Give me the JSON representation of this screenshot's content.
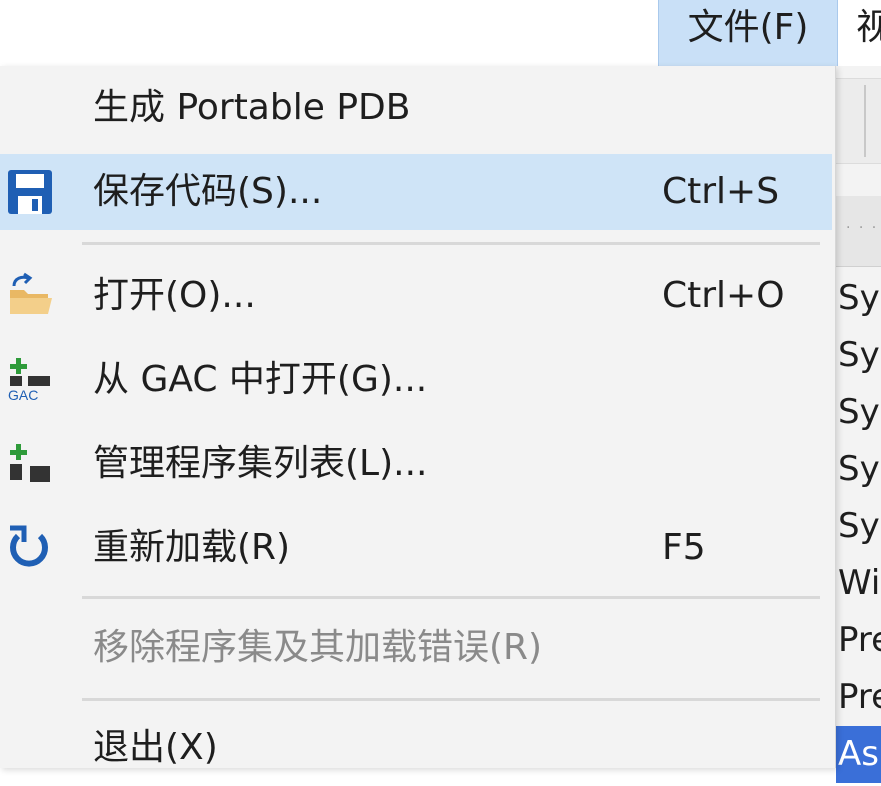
{
  "menubar": {
    "file_label": "文件(F)",
    "next_label": "视"
  },
  "menu": {
    "items": [
      {
        "label": "生成 Portable PDB",
        "shortcut": ""
      },
      {
        "label": "保存代码(S)...",
        "shortcut": "Ctrl+S",
        "icon": "save-icon"
      },
      {
        "label": "打开(O)...",
        "shortcut": "Ctrl+O",
        "icon": "open-folder-icon"
      },
      {
        "label": "从 GAC 中打开(G)...",
        "shortcut": "",
        "icon": "gac-icon"
      },
      {
        "label": "管理程序集列表(L)...",
        "shortcut": "",
        "icon": "assembly-list-icon"
      },
      {
        "label": "重新加载(R)",
        "shortcut": "F5",
        "icon": "reload-icon"
      },
      {
        "label": "移除程序集及其加载错误(R)",
        "shortcut": "",
        "disabled": true
      },
      {
        "label": "退出(X)",
        "shortcut": ""
      }
    ]
  },
  "background_list": [
    "Sys",
    "Sys",
    "Sys",
    "Sys",
    "Sys",
    "Wi",
    "Pre",
    "Pre",
    "As"
  ],
  "colors": {
    "hover": "#cfe4f7",
    "menu_bg": "#f3f3f3",
    "icon_blue": "#1f5fb4",
    "disabled_text": "#8a8a8a"
  }
}
